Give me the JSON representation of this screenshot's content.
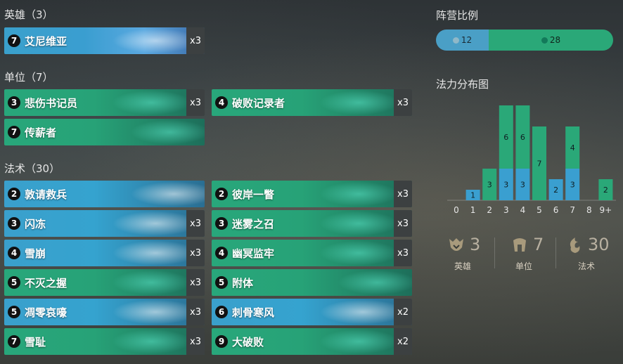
{
  "sections": {
    "champions": "英雄（3）",
    "units": "单位（7）",
    "spells": "法术（30）"
  },
  "champions": [
    {
      "cost": "7",
      "name": "艾尼维亚",
      "count": "x3",
      "type": "champ"
    }
  ],
  "units": [
    {
      "cost": "3",
      "name": "悲伤书记员",
      "count": "x3",
      "type": "unit"
    },
    {
      "cost": "4",
      "name": "破败记录者",
      "count": "x3",
      "type": "unit"
    },
    {
      "cost": "7",
      "name": "传薪者",
      "count": "",
      "type": "unit"
    }
  ],
  "spells_left": [
    {
      "cost": "2",
      "name": "敦请救兵",
      "count": "",
      "type": "spell"
    },
    {
      "cost": "3",
      "name": "闪冻",
      "count": "x3",
      "type": "spell"
    },
    {
      "cost": "4",
      "name": "雪崩",
      "count": "x3",
      "type": "spell"
    },
    {
      "cost": "5",
      "name": "不灭之握",
      "count": "x3",
      "type": "unit"
    },
    {
      "cost": "5",
      "name": "凋零哀嚎",
      "count": "x3",
      "type": "spell"
    },
    {
      "cost": "7",
      "name": "雪耻",
      "count": "x3",
      "type": "unit"
    }
  ],
  "spells_right": [
    {
      "cost": "2",
      "name": "彼岸一瞥",
      "count": "x3",
      "type": "unit"
    },
    {
      "cost": "3",
      "name": "迷雾之召",
      "count": "x3",
      "type": "unit"
    },
    {
      "cost": "4",
      "name": "幽冥监牢",
      "count": "x3",
      "type": "unit"
    },
    {
      "cost": "5",
      "name": "附体",
      "count": "",
      "type": "unit"
    },
    {
      "cost": "6",
      "name": "刺骨寒风",
      "count": "x2",
      "type": "spell"
    },
    {
      "cost": "9",
      "name": "大破败",
      "count": "x2",
      "type": "unit"
    }
  ],
  "region_ratio": {
    "title": "阵营比例",
    "freljord": {
      "value": "12",
      "icon": "freljord-icon",
      "color": "#4a9fc6"
    },
    "shadow_isles": {
      "value": "28",
      "icon": "shadow-isles-icon",
      "color": "#2aa878"
    }
  },
  "chart_data": {
    "type": "bar",
    "title": "法力分布图",
    "categories": [
      "0",
      "1",
      "2",
      "3",
      "4",
      "5",
      "6",
      "7",
      "8",
      "9+"
    ],
    "series": [
      {
        "values": [
          0,
          1,
          0,
          3,
          3,
          0,
          2,
          3,
          0,
          0
        ],
        "color": "#3a9fd0"
      },
      {
        "values": [
          0,
          0,
          3,
          6,
          6,
          7,
          0,
          4,
          0,
          2
        ],
        "color": "#2aa878"
      }
    ],
    "ylim": [
      0,
      9
    ]
  },
  "stats": [
    {
      "value": "3",
      "label": "英雄",
      "icon": "champion-icon"
    },
    {
      "value": "7",
      "label": "单位",
      "icon": "unit-icon"
    },
    {
      "value": "30",
      "label": "法术",
      "icon": "spell-icon"
    }
  ]
}
